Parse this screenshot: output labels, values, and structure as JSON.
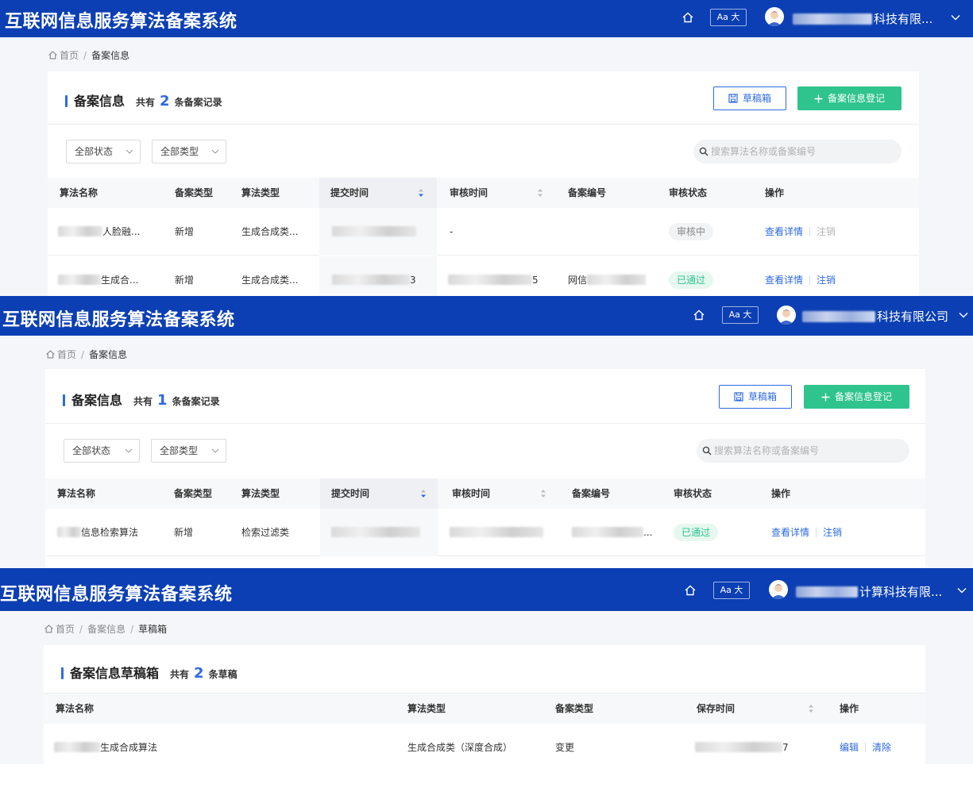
{
  "colors": {
    "header_bg": "#0b3fb3",
    "accent": "#2d6ae0",
    "success": "#2fc48d"
  },
  "app_title": "互联网信息服务算法备案系统",
  "header": {
    "font_button_label": "Aa 大"
  },
  "panel1": {
    "user_name": "科技有限...",
    "breadcrumb": {
      "home": "首页",
      "current": "备案信息"
    },
    "card": {
      "title": "备案信息",
      "count_prefix": "共有",
      "count": "2",
      "count_suffix": "条备案记录",
      "draft_button": "草稿箱",
      "add_button": "备案信息登记"
    },
    "filters": {
      "status": "全部状态",
      "type": "全部类型",
      "search_placeholder": "搜索算法名称或备案编号"
    },
    "columns": [
      "算法名称",
      "备案类型",
      "算法类型",
      "提交时间",
      "审核时间",
      "备案编号",
      "审核状态",
      "操作"
    ],
    "rows": [
      {
        "name": "人脸融...",
        "filing_type": "新增",
        "algo_type": "生成合成类...",
        "submit_time_tail": "",
        "review_time": "-",
        "filing_no": "",
        "status": "审核中",
        "action_view": "查看详情",
        "action_cancel": "注销"
      },
      {
        "name": "生成合...",
        "filing_type": "新增",
        "algo_type": "生成合成类...",
        "submit_time_tail": "3",
        "review_time_tail": "5",
        "filing_no": "网信",
        "status": "已通过",
        "action_view": "查看详情",
        "action_cancel": "注销"
      }
    ]
  },
  "panel2": {
    "user_name": "科技有限公司",
    "breadcrumb": {
      "home": "首页",
      "current": "备案信息"
    },
    "card": {
      "title": "备案信息",
      "count_prefix": "共有",
      "count": "1",
      "count_suffix": "条备案记录",
      "draft_button": "草稿箱",
      "add_button": "备案信息登记"
    },
    "filters": {
      "status": "全部状态",
      "type": "全部类型",
      "search_placeholder": "搜索算法名称或备案编号"
    },
    "columns": [
      "算法名称",
      "备案类型",
      "算法类型",
      "提交时间",
      "审核时间",
      "备案编号",
      "审核状态",
      "操作"
    ],
    "rows": [
      {
        "name": "信息检索算法",
        "filing_type": "新增",
        "algo_type": "检索过滤类",
        "filing_no_tail": "...",
        "status": "已通过",
        "action_view": "查看详情",
        "action_cancel": "注销"
      }
    ]
  },
  "panel3": {
    "user_name": "计算科技有限...",
    "breadcrumb": {
      "home": "首页",
      "middle": "备案信息",
      "current": "草稿箱"
    },
    "card": {
      "title": "备案信息草稿箱",
      "count_prefix": "共有",
      "count": "2",
      "count_suffix": "条草稿"
    },
    "columns": [
      "算法名称",
      "算法类型",
      "备案类型",
      "保存时间",
      "操作"
    ],
    "rows": [
      {
        "name": "生成合成算法",
        "algo_type": "生成合成类（深度合成）",
        "filing_type": "变更",
        "save_time_tail": "7",
        "action_edit": "编辑",
        "action_clear": "清除"
      }
    ]
  }
}
